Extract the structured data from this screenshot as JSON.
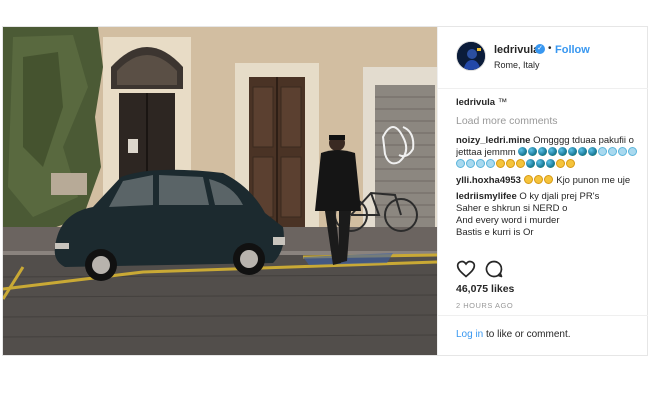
{
  "post": {
    "photo_alt": "",
    "header": {
      "username": "ledrivula",
      "follow_label": "Follow",
      "separator": "•",
      "location": "Rome, Italy"
    },
    "caption": {
      "author": "ledrivula",
      "text": "™"
    },
    "load_more_label": "Load more comments",
    "comments": [
      {
        "author": "noizy_ledri.mine",
        "text": "Omgggg tduaa pakufii o jetttaa jemmm",
        "emoji_sequence": [
          "earth",
          "earth",
          "earth",
          "earth",
          "earth",
          "earth",
          "earth",
          "earth",
          "rain",
          "rain",
          "rain",
          "rain",
          "rain",
          "rain",
          "rain",
          "rain",
          "face",
          "face",
          "face",
          "earth",
          "earth",
          "earth",
          "face",
          "face"
        ]
      },
      {
        "author": "ylli.hoxha4953",
        "text": "Kjo punon me uje",
        "emoji_sequence": [
          "sweat",
          "sweat",
          "sweat"
        ]
      },
      {
        "author": "ledriismylifee",
        "text": "O ky djali prej PR's",
        "lines": [
          "Saher e shkrun si NERD o",
          "And every word i murder",
          "Bastis e kurri is Or"
        ]
      }
    ],
    "actions": {
      "like_icon": "heart-icon",
      "comment_icon": "comment-bubble-icon"
    },
    "likes": "46,075 likes",
    "timestamp": "2 HOURS AGO",
    "login": {
      "link_text": "Log in",
      "rest_text": " to like or comment."
    }
  },
  "colors": {
    "link_blue": "#3897f0",
    "text": "#262626",
    "muted": "#999999"
  }
}
